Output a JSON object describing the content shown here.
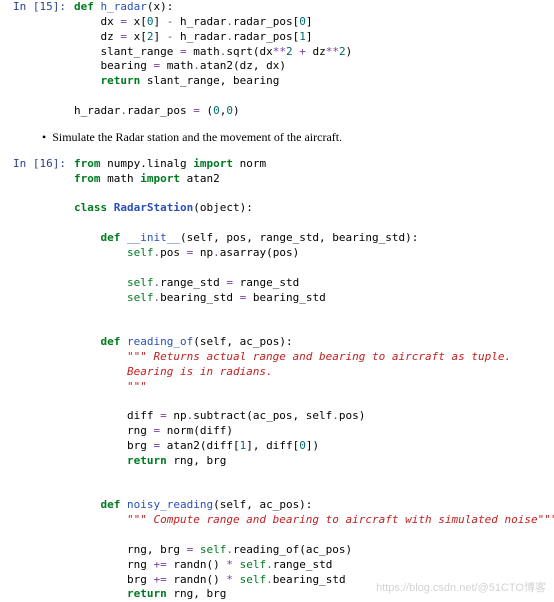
{
  "cell15": {
    "prompt": "In [15]:",
    "l1_kw": "def",
    "l1_fn": "h_radar",
    "l1_rest": "(x):",
    "l2a": "    dx ",
    "l2b": "=",
    "l2c": " x[",
    "l2d": "0",
    "l2e": "] ",
    "l2f": "-",
    "l2g": " h_radar",
    "l2h": ".",
    "l2i": "radar_pos[",
    "l2j": "0",
    "l2k": "]",
    "l3a": "    dz ",
    "l3b": "=",
    "l3c": " x[",
    "l3d": "2",
    "l3e": "] ",
    "l3f": "-",
    "l3g": " h_radar",
    "l3h": ".",
    "l3i": "radar_pos[",
    "l3j": "1",
    "l3k": "]",
    "l4a": "    slant_range ",
    "l4b": "=",
    "l4c": " math",
    "l4d": ".",
    "l4e": "sqrt(dx",
    "l4f": "**",
    "l4g": "2",
    "l4h": " ",
    "l4i": "+",
    "l4j": " dz",
    "l4k": "**",
    "l4l": "2",
    "l4m": ")",
    "l5a": "    bearing ",
    "l5b": "=",
    "l5c": " math",
    "l5d": ".",
    "l5e": "atan2(dz, dx)",
    "l6a": "    ",
    "l6kw": "return",
    "l6b": " slant_range, bearing",
    "l7": "",
    "l8a": "h_radar",
    "l8b": ".",
    "l8c": "radar_pos ",
    "l8d": "=",
    "l8e": " (",
    "l8f": "0",
    "l8g": ",",
    "l8h": "0",
    "l8i": ")"
  },
  "markdown": {
    "bullet": "•",
    "text": "Simulate the Radar station and the movement of the aircraft."
  },
  "cell16": {
    "prompt": "In [16]:",
    "l1_kw1": "from",
    "l1_a": " numpy.linalg ",
    "l1_kw2": "import",
    "l1_b": " norm",
    "l2_kw1": "from",
    "l2_a": " math ",
    "l2_kw2": "import",
    "l2_b": " atan2",
    "emp": "",
    "l4_kw": "class",
    "l4_cls": " RadarStation",
    "l4_rest": "(object):",
    "l6_def": "def",
    "l6_fn": " __init__",
    "l6_rest": "(self, pos, range_std, bearing_std):",
    "l7a": "        self",
    "l7b": ".",
    "l7c": "pos ",
    "l7d": "=",
    "l7e": " np",
    "l7f": ".",
    "l7g": "asarray(pos)",
    "l9a": "        self",
    "l9b": ".",
    "l9c": "range_std ",
    "l9d": "=",
    "l9e": " range_std",
    "l10a": "        self",
    "l10b": ".",
    "l10c": "bearing_std ",
    "l10d": "=",
    "l10e": " bearing_std",
    "l13_def": "def",
    "l13_fn": " reading_of",
    "l13_rest": "(self, ac_pos):",
    "l14": "        \"\"\" Returns actual range and bearing to aircraft as tuple.",
    "l15": "        Bearing is in radians.",
    "l16": "        \"\"\"",
    "l18a": "        diff ",
    "l18b": "=",
    "l18c": " np",
    "l18d": ".",
    "l18e": "subtract(ac_pos, self",
    "l18f": ".",
    "l18g": "pos)",
    "l19a": "        rng ",
    "l19b": "=",
    "l19c": " norm(diff)",
    "l20a": "        brg ",
    "l20b": "=",
    "l20c": " atan2(diff[",
    "l20d": "1",
    "l20e": "], diff[",
    "l20f": "0",
    "l20g": "])",
    "l21a": "        ",
    "l21kw": "return",
    "l21b": " rng, brg",
    "l24_def": "def",
    "l24_fn": " noisy_reading",
    "l24_rest": "(self, ac_pos):",
    "l25": "        \"\"\" Compute range and bearing to aircraft with simulated noise\"\"\"",
    "l27a": "        rng, brg ",
    "l27b": "=",
    "l27c": " self",
    "l27d": ".",
    "l27e": "reading_of(ac_pos)",
    "l28a": "        rng ",
    "l28b": "+=",
    "l28c": " randn() ",
    "l28d": "*",
    "l28e": " self",
    "l28f": ".",
    "l28g": "range_std",
    "l29a": "        brg ",
    "l29b": "+=",
    "l29c": " randn() ",
    "l29d": "*",
    "l29e": " self",
    "l29f": ".",
    "l29g": "bearing_std",
    "l30a": "        ",
    "l30kw": "return",
    "l30b": " rng, brg"
  },
  "watermark": "https://blog.csdn.net/@51CTO博客"
}
